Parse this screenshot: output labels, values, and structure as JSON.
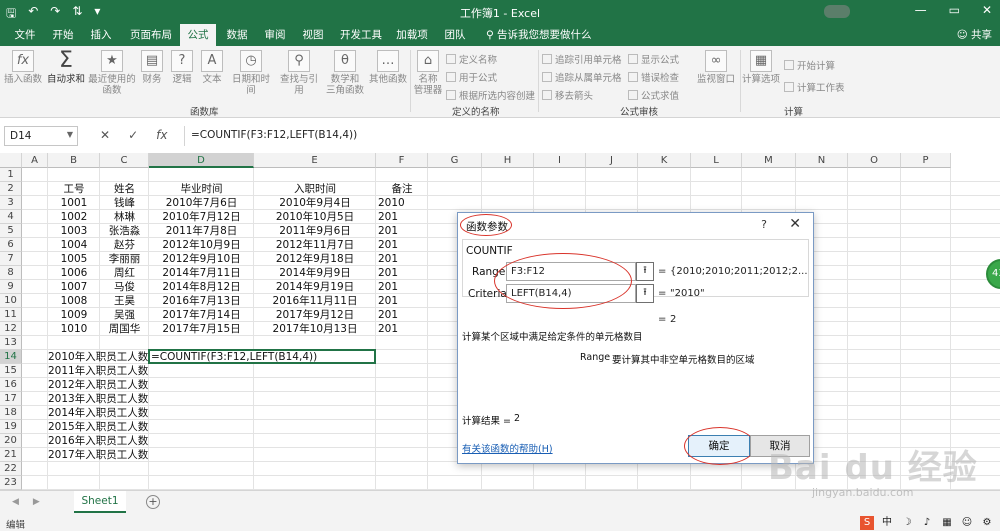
{
  "window": {
    "title": "工作簿1 - Excel",
    "minimize": "—",
    "restore": "▭",
    "close": "✕"
  },
  "qat": {
    "save": "🖫",
    "undo": "↶",
    "redo": "↷",
    "custom": "⇅",
    "more": "▾"
  },
  "tabs": [
    "文件",
    "开始",
    "插入",
    "页面布局",
    "公式",
    "数据",
    "审阅",
    "视图",
    "开发工具",
    "加载项",
    "团队"
  ],
  "active_tab": "公式",
  "tell_me": "告诉我您想要做什么",
  "share": "共享",
  "ribbon": {
    "function_library": {
      "group_label": "函数库",
      "insert_function": "插入函数",
      "autosum": "自动求和",
      "recent": "最近使用的\n函数",
      "financial": "财务",
      "logical": "逻辑",
      "text": "文本",
      "datetime": "日期和时间",
      "lookup": "查找与引用",
      "math": "数学和\n三角函数",
      "other": "其他函数"
    },
    "defined_names": {
      "group_label": "定义的名称",
      "name_manager": "名称\n管理器",
      "define_name": "定义名称",
      "use_in_formula": "用于公式",
      "create_from_selection": "根据所选内容创建"
    },
    "formula_auditing": {
      "group_label": "公式审核",
      "trace_precedents": "追踪引用单元格",
      "trace_dependents": "追踪从属单元格",
      "remove_arrows": "移去箭头",
      "show_formulas": "显示公式",
      "error_checking": "错误检查",
      "evaluate_formula": "公式求值",
      "watch_window": "监视窗口"
    },
    "calculation": {
      "group_label": "计算",
      "calc_options": "计算选项",
      "calc_now": "开始计算",
      "calc_sheet": "计算工作表"
    }
  },
  "formula_bar": {
    "name_box": "D14",
    "cancel": "✕",
    "enter": "✓",
    "fx": "fx",
    "formula": "=COUNTIF(F3:F12,LEFT(B14,4))"
  },
  "columns": [
    "A",
    "B",
    "C",
    "D",
    "E",
    "F",
    "G",
    "H",
    "I",
    "J",
    "K",
    "L",
    "M",
    "N",
    "O",
    "P"
  ],
  "rows": [
    "1",
    "2",
    "3",
    "4",
    "5",
    "6",
    "7",
    "8",
    "9",
    "10",
    "11",
    "12",
    "13",
    "14",
    "15",
    "16",
    "17",
    "18",
    "19",
    "20",
    "21",
    "22",
    "23",
    "24"
  ],
  "selected_cell": {
    "col": "D",
    "row": "14"
  },
  "table": {
    "headers": {
      "b": "工号",
      "c": "姓名",
      "d": "毕业时间",
      "e": "入职时间",
      "f": "备注"
    },
    "rows": [
      {
        "b": "1001",
        "c": "钱峰",
        "d": "2010年7月6日",
        "e": "2010年9月4日",
        "f": "2010"
      },
      {
        "b": "1002",
        "c": "林琳",
        "d": "2010年7月12日",
        "e": "2010年10月5日",
        "f": "201"
      },
      {
        "b": "1003",
        "c": "张浩淼",
        "d": "2011年7月8日",
        "e": "2011年9月6日",
        "f": "201"
      },
      {
        "b": "1004",
        "c": "赵芬",
        "d": "2012年10月9日",
        "e": "2012年11月7日",
        "f": "201"
      },
      {
        "b": "1005",
        "c": "李丽丽",
        "d": "2012年9月10日",
        "e": "2012年9月18日",
        "f": "201"
      },
      {
        "b": "1006",
        "c": "周红",
        "d": "2014年7月11日",
        "e": "2014年9月9日",
        "f": "201"
      },
      {
        "b": "1007",
        "c": "马俊",
        "d": "2014年8月12日",
        "e": "2014年9月19日",
        "f": "201"
      },
      {
        "b": "1008",
        "c": "王昊",
        "d": "2016年7月13日",
        "e": "2016年11月11日",
        "f": "201"
      },
      {
        "b": "1009",
        "c": "吴强",
        "d": "2017年7月14日",
        "e": "2017年9月12日",
        "f": "201"
      },
      {
        "b": "1010",
        "c": "周国华",
        "d": "2017年7月15日",
        "e": "2017年10月13日",
        "f": "201"
      }
    ],
    "summary_labels": [
      "2010年入职员工人数",
      "2011年入职员工人数",
      "2012年入职员工人数",
      "2013年入职员工人数",
      "2014年入职员工人数",
      "2015年入职员工人数",
      "2016年入职员工人数",
      "2017年入职员工人数"
    ],
    "d14_formula": "=COUNTIF(F3:F12,LEFT(B14,4))"
  },
  "sheet_tabs": [
    "Sheet1"
  ],
  "sheet_nav": {
    "prev": "◀",
    "next": "▶"
  },
  "add_sheet": "+",
  "status": {
    "mode": "编辑"
  },
  "tray_icons": [
    "S",
    "中",
    "☽",
    "♪",
    "▦",
    "☺",
    "⚙"
  ],
  "side_bubble": "43",
  "dialog": {
    "title": "函数参数",
    "help": "?",
    "close": "✕",
    "function_name": "COUNTIF",
    "args": [
      {
        "label": "Range",
        "value": "F3:F12",
        "result": "{2010;2010;2011;2012;2..."
      },
      {
        "label": "Criteria",
        "value": "LEFT(B14,4)",
        "result": "\"2010\""
      }
    ],
    "equals": "=",
    "ref_button": "⭱",
    "overall_result": "2",
    "description": "计算某个区域中满足给定条件的单元格数目",
    "arg_help_name": "Range",
    "arg_help_text": "要计算其中非空单元格数目的区域",
    "calc_result_label": "计算结果 =",
    "calc_result_value": "2",
    "help_link": "有关该函数的帮助(H)",
    "ok": "确定",
    "cancel": "取消"
  },
  "watermark": {
    "logo": "Bai du 经验",
    "url": "jingyan.baidu.com"
  },
  "colors": {
    "excel_green": "#217346",
    "annotation_red": "#d9342b",
    "link_blue": "#1a5fb4"
  }
}
